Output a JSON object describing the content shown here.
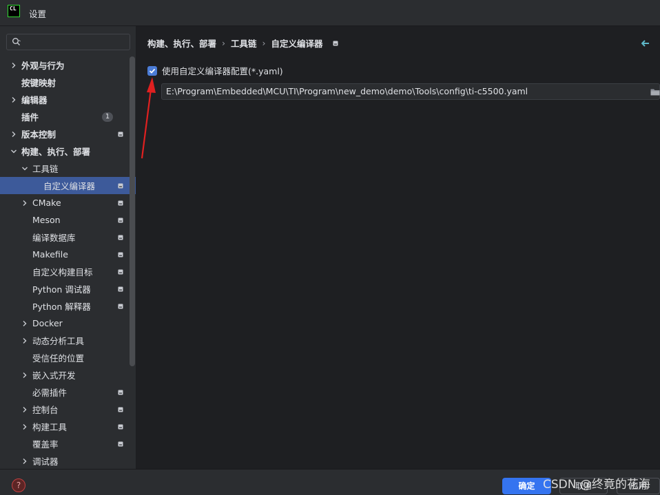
{
  "window": {
    "title": "设置",
    "logo_text": "CL"
  },
  "search": {
    "placeholder": ""
  },
  "tree": [
    {
      "label": "外观与行为",
      "bold": true,
      "chevron": "right"
    },
    {
      "label": "按键映射",
      "bold": true,
      "chevron": ""
    },
    {
      "label": "编辑器",
      "bold": true,
      "chevron": "right"
    },
    {
      "label": "插件",
      "bold": true,
      "chevron": "",
      "badge": "1"
    },
    {
      "label": "版本控制",
      "bold": true,
      "chevron": "right",
      "project": true
    },
    {
      "label": "构建、执行、部署",
      "bold": true,
      "chevron": "down"
    },
    {
      "label": "工具链",
      "bold": false,
      "chevron": "down"
    },
    {
      "label": "自定义编译器",
      "bold": false,
      "chevron": "",
      "project": true,
      "selected": true
    },
    {
      "label": "CMake",
      "bold": false,
      "chevron": "right",
      "project": true
    },
    {
      "label": "Meson",
      "bold": false,
      "chevron": "",
      "project": true
    },
    {
      "label": "编译数据库",
      "bold": false,
      "chevron": "",
      "project": true
    },
    {
      "label": "Makefile",
      "bold": false,
      "chevron": "",
      "project": true
    },
    {
      "label": "自定义构建目标",
      "bold": false,
      "chevron": "",
      "project": true
    },
    {
      "label": "Python 调试器",
      "bold": false,
      "chevron": "",
      "project": true
    },
    {
      "label": "Python 解释器",
      "bold": false,
      "chevron": "",
      "project": true
    },
    {
      "label": "Docker",
      "bold": false,
      "chevron": "right"
    },
    {
      "label": "动态分析工具",
      "bold": false,
      "chevron": "right"
    },
    {
      "label": "受信任的位置",
      "bold": false,
      "chevron": ""
    },
    {
      "label": "嵌入式开发",
      "bold": false,
      "chevron": "right"
    },
    {
      "label": "必需插件",
      "bold": false,
      "chevron": "",
      "project": true
    },
    {
      "label": "控制台",
      "bold": false,
      "chevron": "right",
      "project": true
    },
    {
      "label": "构建工具",
      "bold": false,
      "chevron": "right",
      "project": true
    },
    {
      "label": "覆盖率",
      "bold": false,
      "chevron": "",
      "project": true
    },
    {
      "label": "调试器",
      "bold": false,
      "chevron": "right"
    }
  ],
  "breadcrumb": [
    "构建、执行、部署",
    "工具链",
    "自定义编译器"
  ],
  "settings": {
    "use_custom_config_label": "使用自定义编译器配置(*.yaml)",
    "use_custom_config_checked": true,
    "config_path": "E:\\Program\\Embedded\\MCU\\TI\\Program\\new_demo\\demo\\Tools\\config\\ti-c5500.yaml"
  },
  "footer": {
    "help_label": "?",
    "ok_label": "确定",
    "cancel_label": "取消",
    "apply_label": "应用"
  },
  "watermark": "CSDN @终竟的花海",
  "colors": {
    "accent": "#3574f0",
    "selection": "#2e436e",
    "annotation_arrow": "#e02020"
  }
}
